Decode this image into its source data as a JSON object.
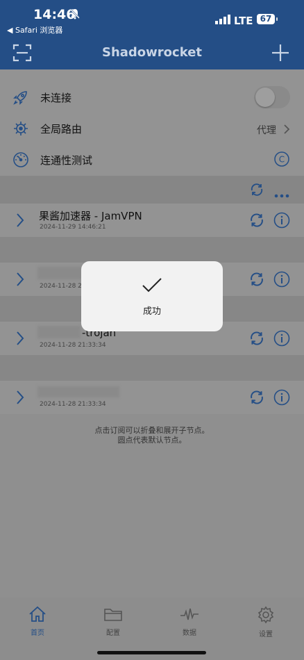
{
  "status": {
    "time": "14:46",
    "back_label": "◀ Safari 浏览器",
    "network": "LTE",
    "battery": "67"
  },
  "app": {
    "title": "Shadowrocket"
  },
  "settings": {
    "connect_label": "未连接",
    "connected": false,
    "routing_label": "全局路由",
    "routing_value": "代理",
    "test_label": "连通性测试"
  },
  "subscriptions": [
    {
      "name": "果酱加速器 - JamVPN",
      "date": "2024-11-29 14:46:21"
    },
    {
      "name": "",
      "date": "2024-11-28 21:33:34"
    },
    {
      "name": "-trojan",
      "date": "2024-11-28 21:33:34"
    },
    {
      "name": "",
      "date": "2024-11-28 21:33:34"
    }
  ],
  "hint": {
    "line1": "点击订阅可以折叠和展开子节点。",
    "line2": "圆点代表默认节点。"
  },
  "toast": {
    "message": "成功"
  },
  "tabs": [
    {
      "label": "首页",
      "icon": "home-icon",
      "active": true
    },
    {
      "label": "配置",
      "icon": "folder-icon",
      "active": false
    },
    {
      "label": "数据",
      "icon": "activity-icon",
      "active": false
    },
    {
      "label": "设置",
      "icon": "gear-icon",
      "active": false
    }
  ],
  "colors": {
    "brand": "#244e86",
    "overlay": "#8f8f8f"
  }
}
